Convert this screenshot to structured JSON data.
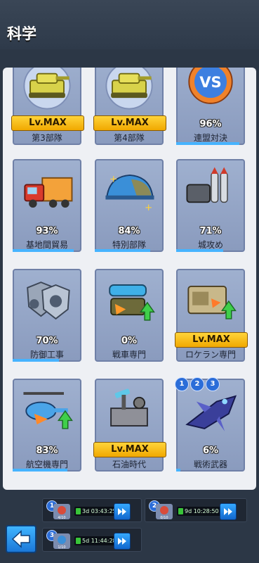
{
  "header": {
    "title": "科学"
  },
  "cards": [
    {
      "name": "第3部隊",
      "level_badge": "Lv.MAX",
      "icon": "tank-gold-icon"
    },
    {
      "name": "第4部隊",
      "level_badge": "Lv.MAX",
      "icon": "tank-gold-icon"
    },
    {
      "name": "連盟対決",
      "percent": "96%",
      "progress": 0.96,
      "icon": "versus-icon"
    },
    {
      "name": "基地間貿易",
      "percent": "93%",
      "progress": 0.93,
      "icon": "truck-icon"
    },
    {
      "name": "特別部隊",
      "percent": "84%",
      "progress": 0.84,
      "icon": "helmet-icon"
    },
    {
      "name": "城攻め",
      "percent": "71%",
      "progress": 0.71,
      "icon": "missiles-icon"
    },
    {
      "name": "防御工事",
      "percent": "70%",
      "progress": 0.7,
      "icon": "shields-icon"
    },
    {
      "name": "戦車専門",
      "percent": "0%",
      "progress": 0.0,
      "icon": "cannon-upgrade-icon"
    },
    {
      "name": "ロケラン専門",
      "level_badge": "Lv.MAX",
      "icon": "rocket-launcher-upgrade-icon"
    },
    {
      "name": "航空機専門",
      "percent": "83%",
      "progress": 0.83,
      "icon": "helicopter-upgrade-icon"
    },
    {
      "name": "石油時代",
      "level_badge": "Lv.MAX",
      "icon": "oil-pump-icon"
    },
    {
      "name": "戦術武器",
      "percent": "6%",
      "progress": 0.06,
      "icon": "jet-fighter-icon",
      "tier_badges": [
        "1",
        "2",
        "3"
      ]
    }
  ],
  "queues": [
    {
      "number": "1",
      "time": "3d 03:43:25",
      "thumb_label": "4/10"
    },
    {
      "number": "2",
      "time": "9d 10:28:50",
      "thumb_label": "0/10"
    },
    {
      "number": "3",
      "time": "5d 11:44:28",
      "thumb_label": "1/10"
    }
  ],
  "colors": {
    "badge": "#f5b800",
    "progress": "#46b3ff",
    "card": "#9aabcc"
  }
}
